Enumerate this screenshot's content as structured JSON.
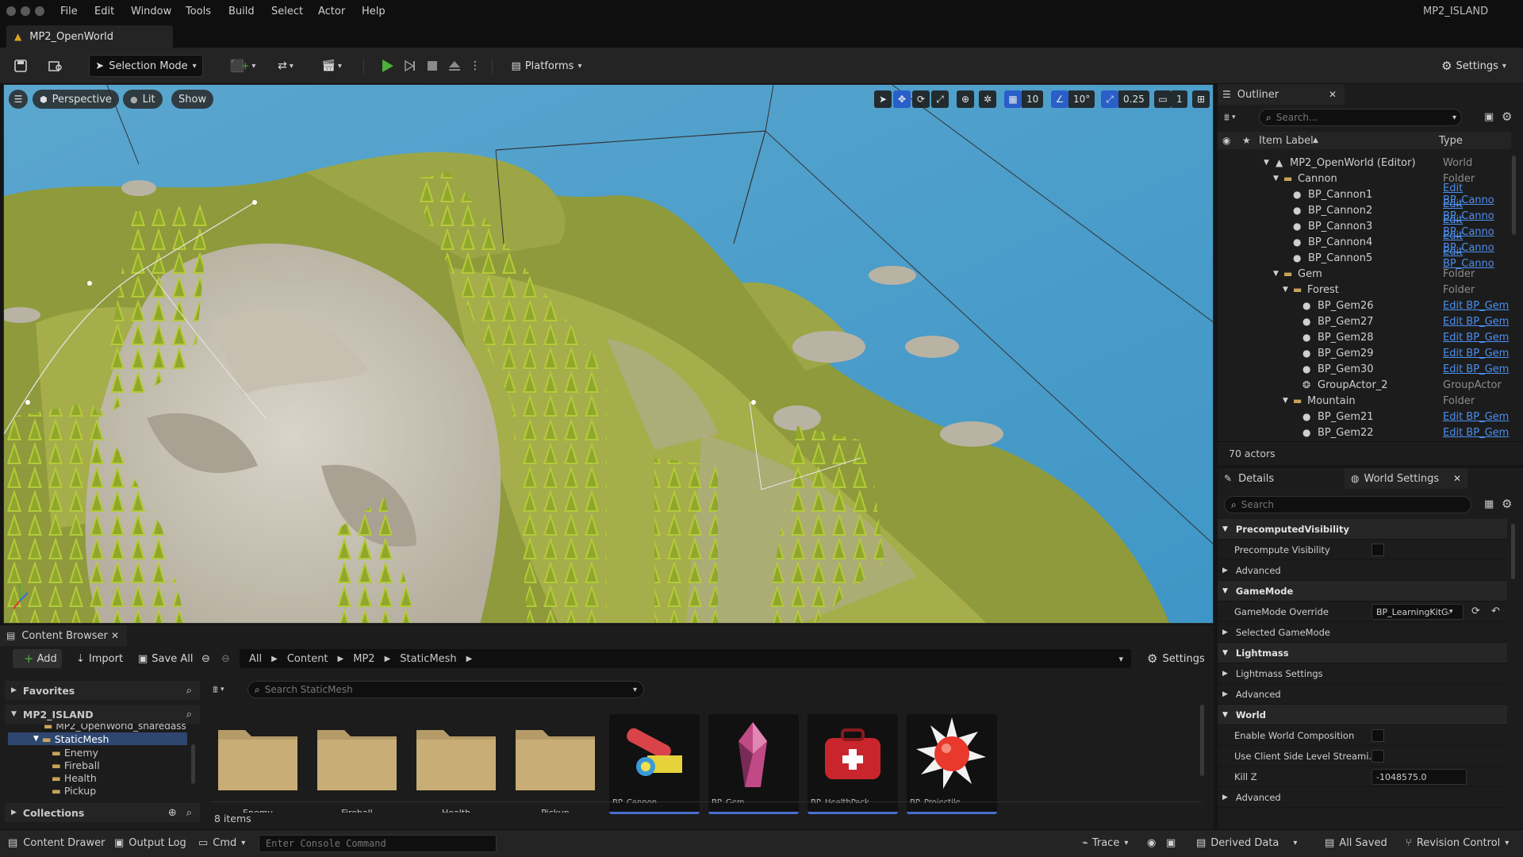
{
  "window": {
    "project_name": "MP2_ISLAND",
    "menu": [
      "File",
      "Edit",
      "Window",
      "Tools",
      "Build",
      "Select",
      "Actor",
      "Help"
    ],
    "doc_tab": "MP2_OpenWorld"
  },
  "toolbar": {
    "selection_mode": "Selection Mode",
    "platforms": "Platforms",
    "settings": "Settings"
  },
  "viewport": {
    "perspective": "Perspective",
    "lit": "Lit",
    "show": "Show",
    "grid_snap": "10",
    "rotation_snap": "10°",
    "scale_snap": "0.25",
    "camera_speed": "1"
  },
  "outliner": {
    "tab": "Outliner",
    "search_placeholder": "Search...",
    "col_label": "Item Label",
    "col_type": "Type",
    "rows": [
      {
        "label": "MP2_OpenWorld (Editor)",
        "type": "World"
      },
      {
        "label": "Cannon",
        "type": "Folder"
      },
      {
        "label": "BP_Cannon1",
        "type": "Edit BP_Canno"
      },
      {
        "label": "BP_Cannon2",
        "type": "Edit BP_Canno"
      },
      {
        "label": "BP_Cannon3",
        "type": "Edit BP_Canno"
      },
      {
        "label": "BP_Cannon4",
        "type": "Edit BP_Canno"
      },
      {
        "label": "BP_Cannon5",
        "type": "Edit BP_Canno"
      },
      {
        "label": "Gem",
        "type": "Folder"
      },
      {
        "label": "Forest",
        "type": "Folder"
      },
      {
        "label": "BP_Gem26",
        "type": "Edit BP_Gem"
      },
      {
        "label": "BP_Gem27",
        "type": "Edit BP_Gem"
      },
      {
        "label": "BP_Gem28",
        "type": "Edit BP_Gem"
      },
      {
        "label": "BP_Gem29",
        "type": "Edit BP_Gem"
      },
      {
        "label": "BP_Gem30",
        "type": "Edit BP_Gem"
      },
      {
        "label": "GroupActor_2",
        "type": "GroupActor"
      },
      {
        "label": "Mountain",
        "type": "Folder"
      },
      {
        "label": "BP_Gem21",
        "type": "Edit BP_Gem"
      },
      {
        "label": "BP_Gem22",
        "type": "Edit BP_Gem"
      }
    ],
    "count": "70 actors"
  },
  "details": {
    "tab_details": "Details",
    "tab_world": "World Settings",
    "search_placeholder": "Search",
    "precomputed": "PrecomputedVisibility",
    "precompute_visibility": "Precompute Visibility",
    "advanced": "Advanced",
    "gamemode": "GameMode",
    "gamemode_override": "GameMode Override",
    "gamemode_value": "BP_LearningKitGa",
    "selected_gamemode": "Selected GameMode",
    "lightmass": "Lightmass",
    "lightmass_settings": "Lightmass Settings",
    "world": "World",
    "enable_world_composition": "Enable World Composition",
    "use_client_side": "Use Client Side Level Streami...",
    "kill_z": "Kill Z",
    "kill_z_value": "-1048575.0"
  },
  "content_browser": {
    "tab": "Content Browser",
    "add": "Add",
    "import": "Import",
    "save_all": "Save All",
    "breadcrumb": [
      "All",
      "Content",
      "MP2",
      "StaticMesh"
    ],
    "settings": "Settings",
    "favorites": "Favorites",
    "project_root": "MP2_ISLAND",
    "tree": [
      "MP2_OpenWorld_sharedass",
      "StaticMesh",
      "Enemy",
      "Fireball",
      "Health",
      "Pickup"
    ],
    "collections": "Collections",
    "search_placeholder": "Search StaticMesh",
    "item_count": "8 items",
    "folders": [
      "Enemy",
      "Fireball",
      "Health",
      "Pickup"
    ],
    "assets": [
      "BP_Cannon",
      "BP_Gem",
      "BP_HealthPack",
      "BP_Projectile"
    ]
  },
  "statusbar": {
    "content_drawer": "Content Drawer",
    "output_log": "Output Log",
    "cmd": "Cmd",
    "console_placeholder": "Enter Console Command",
    "trace": "Trace",
    "derived_data": "Derived Data",
    "all_saved": "All Saved",
    "revision_control": "Revision Control"
  },
  "colors": {
    "accent": "#2a5ec8",
    "link": "#4b8ff0",
    "play": "#4caf3a"
  }
}
